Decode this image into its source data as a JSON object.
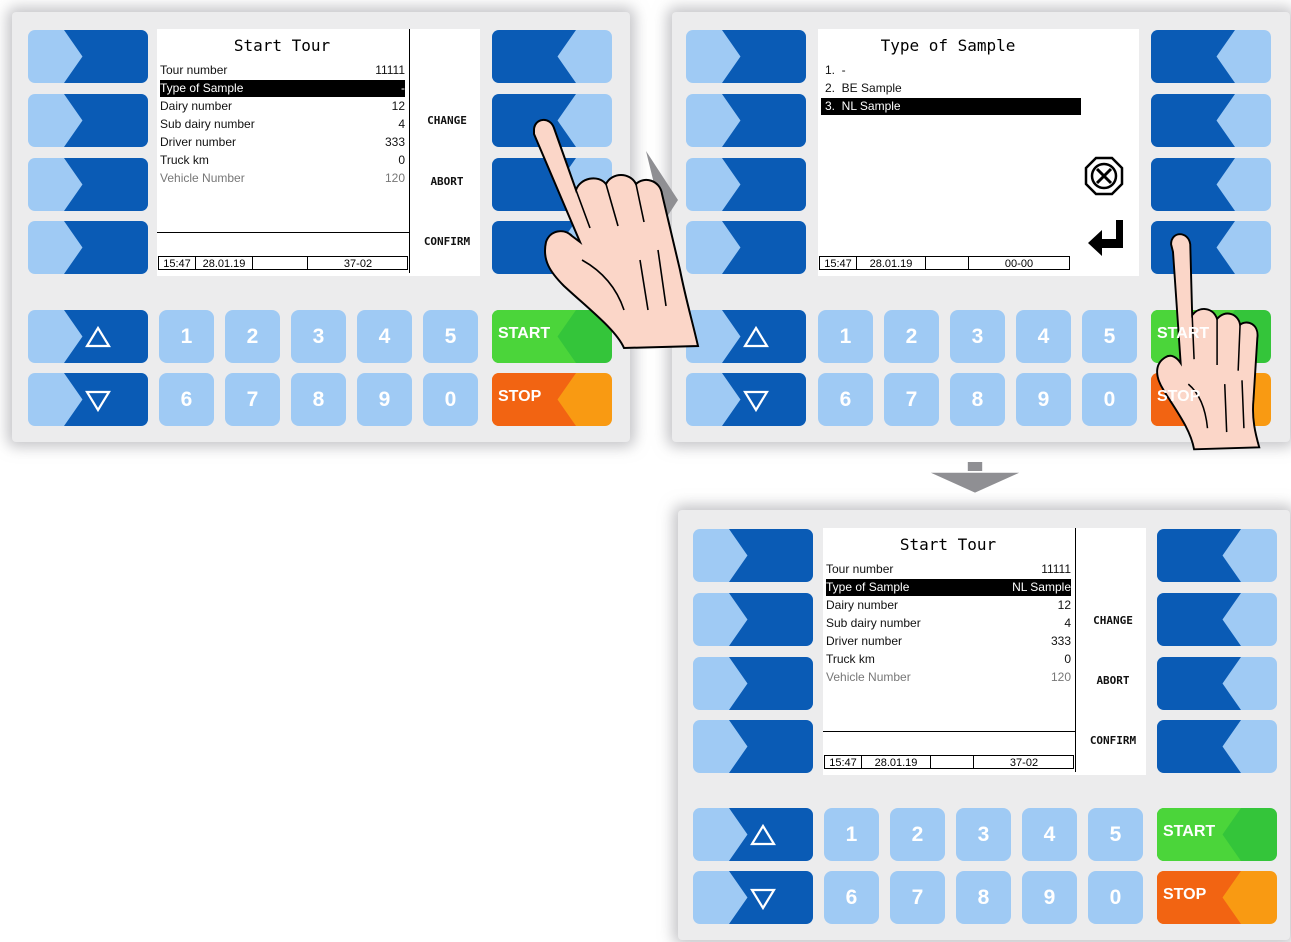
{
  "start_tour": {
    "title": "Start Tour",
    "rows": [
      {
        "label": "Tour number",
        "value": "11111"
      },
      {
        "label": "Type of Sample",
        "value": "-"
      },
      {
        "label": "Dairy number",
        "value": "12"
      },
      {
        "label": "Sub dairy number",
        "value": "4"
      },
      {
        "label": "Driver number",
        "value": "333"
      },
      {
        "label": "Truck km",
        "value": "0"
      },
      {
        "label": "Vehicle Number",
        "value": "120"
      }
    ],
    "status": {
      "time": "15:47",
      "date": "28.01.19",
      "blank": "",
      "code": "37-02"
    },
    "softkeys": {
      "change": "CHANGE",
      "abort": "ABORT",
      "confirm": "CONFIRM"
    }
  },
  "type_of_sample": {
    "title": "Type of Sample",
    "items": [
      "1.  -",
      "2.  BE Sample",
      "3.  NL Sample"
    ],
    "status": {
      "time": "15:47",
      "date": "28.01.19",
      "blank": "",
      "code": "00-00"
    },
    "cancel_icon": "cancel-icon",
    "enter_icon": "enter-icon"
  },
  "start_tour_result": {
    "title": "Start Tour",
    "rows": [
      {
        "label": "Tour number",
        "value": "11111"
      },
      {
        "label": "Type of Sample",
        "value": "NL Sample"
      },
      {
        "label": "Dairy number",
        "value": "12"
      },
      {
        "label": "Sub dairy number",
        "value": "4"
      },
      {
        "label": "Driver number",
        "value": "333"
      },
      {
        "label": "Truck km",
        "value": "0"
      },
      {
        "label": "Vehicle Number",
        "value": "120"
      }
    ],
    "status": {
      "time": "15:47",
      "date": "28.01.19",
      "blank": "",
      "code": "37-02"
    },
    "softkeys": {
      "change": "CHANGE",
      "abort": "ABORT",
      "confirm": "CONFIRM"
    }
  },
  "keypad": {
    "digits_top": [
      "1",
      "2",
      "3",
      "4",
      "5"
    ],
    "digits_bottom": [
      "6",
      "7",
      "8",
      "9",
      "0"
    ],
    "start": "START",
    "stop": "STOP",
    "up_icon": "triangle-up-icon",
    "down_icon": "triangle-down-icon"
  },
  "colors": {
    "button_dark_blue": "#0a5bb5",
    "button_light_blue": "#9fcaf4",
    "start_green": "#34c53a",
    "stop_orange": "#f26412",
    "panel_gray": "#ececed"
  }
}
